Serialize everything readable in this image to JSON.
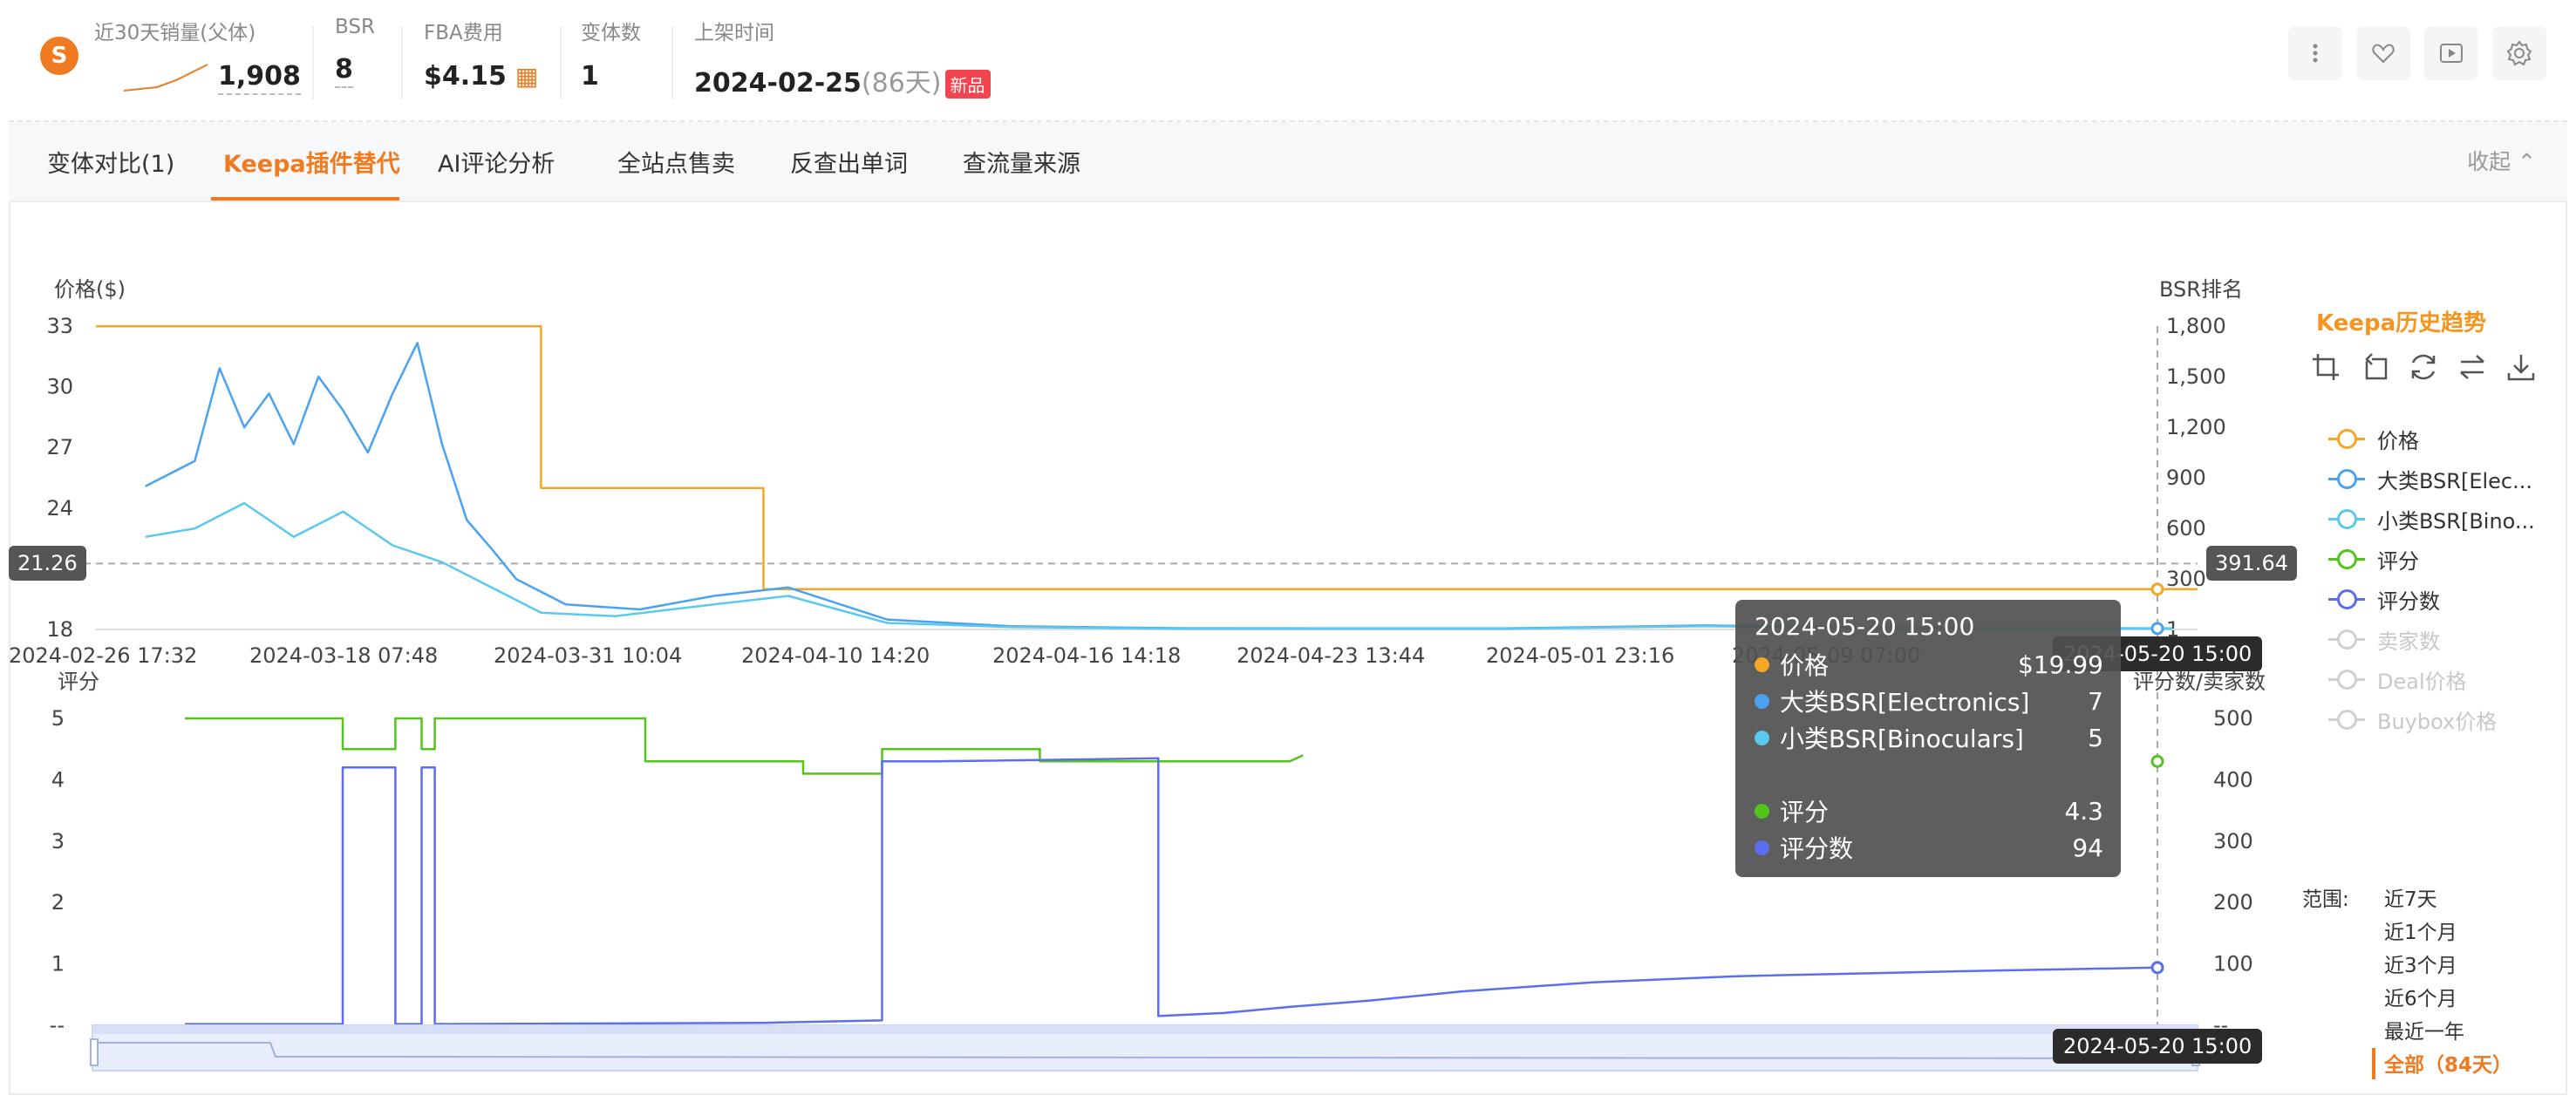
{
  "stats": {
    "sales_label": "近30天销量(父体)",
    "sales_value": "1,908",
    "bsr_label": "BSR",
    "bsr_value": "8",
    "fba_label": "FBA费用",
    "fba_value": "$4.15",
    "variants_label": "变体数",
    "variants_value": "1",
    "launch_label": "上架时间",
    "launch_date": "2024-02-25",
    "launch_days": "(86天)",
    "new_badge": "新品"
  },
  "toolbar_icons": [
    "more-icon",
    "heart-icon",
    "video-icon",
    "settings-icon"
  ],
  "tabs": [
    {
      "label": "变体对比(1)",
      "active": false
    },
    {
      "label": "Keepa插件替代",
      "active": true
    },
    {
      "label": "AI评论分析",
      "active": false
    },
    {
      "label": "全站点售卖",
      "active": false
    },
    {
      "label": "反查出单词",
      "active": false
    },
    {
      "label": "查流量来源",
      "active": false
    }
  ],
  "collapse_label": "收起",
  "keepa": {
    "title": "Keepa历史趋势",
    "tools": [
      "zoom-in-icon",
      "zoom-reset-icon",
      "refresh-icon",
      "swap-icon",
      "download-icon"
    ],
    "legend": [
      {
        "label": "价格",
        "color": "#f5a623",
        "active": true
      },
      {
        "label": "大类BSR[Elec...",
        "color": "#4aa3f0",
        "active": true
      },
      {
        "label": "小类BSR[Bino...",
        "color": "#5bc8ef",
        "active": true
      },
      {
        "label": "评分",
        "color": "#52c41a",
        "active": true
      },
      {
        "label": "评分数",
        "color": "#5b6ef0",
        "active": true
      },
      {
        "label": "卖家数",
        "color": "#d0d0d0",
        "active": false
      },
      {
        "label": "Deal价格",
        "color": "#d0d0d0",
        "active": false
      },
      {
        "label": "Buybox价格",
        "color": "#d0d0d0",
        "active": false
      }
    ],
    "range_label": "范围:",
    "range_options": [
      "近7天",
      "近1个月",
      "近3个月",
      "近6个月",
      "最近一年",
      "全部（84天）"
    ],
    "range_active": 5
  },
  "tooltip": {
    "title": "2024-05-20 15:00",
    "rows": [
      {
        "name": "价格",
        "value": "$19.99",
        "color": "#f5a623"
      },
      {
        "name": "大类BSR[Electronics]",
        "value": "7",
        "color": "#4aa3f0"
      },
      {
        "name": "小类BSR[Binoculars]",
        "value": "5",
        "color": "#5bc8ef"
      },
      {
        "name": "评分",
        "value": "4.3",
        "color": "#52c41a"
      },
      {
        "name": "评分数",
        "value": "94",
        "color": "#5b6ef0"
      }
    ]
  },
  "crosshair": {
    "price_value": "21.26",
    "bsr_value": "391.64",
    "time_label": "2024-05-20 15:00",
    "time_label_bottom": "2024-05-20 15:00"
  },
  "chart_data": [
    {
      "type": "line",
      "title": "",
      "ylabel": "价格($)",
      "ylabel_right": "BSR排名",
      "ylim": [
        18,
        33
      ],
      "ylim_right": [
        1,
        1800
      ],
      "yticks": [
        "33",
        "30",
        "27",
        "24",
        "21",
        "18"
      ],
      "yticks_right": [
        "1,800",
        "1,500",
        "1,200",
        "900",
        "600",
        "300",
        "1"
      ],
      "x_tick_labels": [
        "2024-02-26 17:32",
        "2024-03-18 07:48",
        "2024-03-31 10:04",
        "2024-04-10 14:20",
        "2024-04-16 14:18",
        "2024-04-23 13:44",
        "2024-05-01 23:16",
        "2024-05-09 07:00",
        "2024-05-20 15:00"
      ],
      "x_start": "2024-02-26",
      "x_end": "2024-05-21",
      "series": [
        {
          "name": "价格",
          "axis": "left",
          "color": "#f5a623",
          "points": [
            [
              "2024-02-26",
              32.99
            ],
            [
              "2024-03-15",
              32.99
            ],
            [
              "2024-03-15",
              24.99
            ],
            [
              "2024-03-24",
              24.99
            ],
            [
              "2024-03-24",
              19.99
            ],
            [
              "2024-05-21",
              19.99
            ]
          ]
        },
        {
          "name": "大类BSR[Electronics]",
          "axis": "right",
          "color": "#4aa3f0",
          "points": [
            [
              "2024-02-28",
              850
            ],
            [
              "2024-03-01",
              1000
            ],
            [
              "2024-03-02",
              1550
            ],
            [
              "2024-03-03",
              1200
            ],
            [
              "2024-03-04",
              1400
            ],
            [
              "2024-03-05",
              1100
            ],
            [
              "2024-03-06",
              1500
            ],
            [
              "2024-03-07",
              1300
            ],
            [
              "2024-03-08",
              1050
            ],
            [
              "2024-03-09",
              1400
            ],
            [
              "2024-03-10",
              1700
            ],
            [
              "2024-03-11",
              1100
            ],
            [
              "2024-03-12",
              650
            ],
            [
              "2024-03-13",
              480
            ],
            [
              "2024-03-14",
              300
            ],
            [
              "2024-03-16",
              150
            ],
            [
              "2024-03-19",
              120
            ],
            [
              "2024-03-22",
              200
            ],
            [
              "2024-03-25",
              250
            ],
            [
              "2024-03-29",
              60
            ],
            [
              "2024-04-03",
              20
            ],
            [
              "2024-04-10",
              8
            ],
            [
              "2024-04-23",
              7
            ],
            [
              "2024-05-01",
              25
            ],
            [
              "2024-05-09",
              10
            ],
            [
              "2024-05-20",
              7
            ]
          ]
        },
        {
          "name": "小类BSR[Binoculars]",
          "axis": "right",
          "color": "#5bc8ef",
          "points": [
            [
              "2024-02-28",
              550
            ],
            [
              "2024-03-01",
              600
            ],
            [
              "2024-03-03",
              750
            ],
            [
              "2024-03-05",
              550
            ],
            [
              "2024-03-07",
              700
            ],
            [
              "2024-03-09",
              500
            ],
            [
              "2024-03-11",
              400
            ],
            [
              "2024-03-13",
              250
            ],
            [
              "2024-03-15",
              100
            ],
            [
              "2024-03-18",
              80
            ],
            [
              "2024-03-22",
              150
            ],
            [
              "2024-03-25",
              200
            ],
            [
              "2024-03-29",
              40
            ],
            [
              "2024-04-03",
              15
            ],
            [
              "2024-04-10",
              5
            ],
            [
              "2024-04-23",
              5
            ],
            [
              "2024-05-01",
              20
            ],
            [
              "2024-05-09",
              8
            ],
            [
              "2024-05-20",
              5
            ]
          ]
        }
      ]
    },
    {
      "type": "line",
      "title": "",
      "ylabel": "评分",
      "ylabel_right": "评分数/卖家数",
      "ylim": [
        0,
        5
      ],
      "ylim_right": [
        0,
        500
      ],
      "yticks": [
        "5",
        "4",
        "3",
        "2",
        "1",
        "--"
      ],
      "yticks_right": [
        "500",
        "400",
        "300",
        "200",
        "100",
        "--"
      ],
      "series": [
        {
          "name": "评分",
          "axis": "left",
          "color": "#52c41a",
          "points": [
            [
              "2024-02-26",
              5.0
            ],
            [
              "2024-03-09",
              5.0
            ],
            [
              "2024-03-09",
              4.5
            ],
            [
              "2024-03-13",
              4.5
            ],
            [
              "2024-03-13",
              5.0
            ],
            [
              "2024-03-15",
              5.0
            ],
            [
              "2024-03-15",
              4.5
            ],
            [
              "2024-03-16",
              4.5
            ],
            [
              "2024-03-16",
              5.0
            ],
            [
              "2024-04-01",
              5.0
            ],
            [
              "2024-04-01",
              4.3
            ],
            [
              "2024-04-13",
              4.3
            ],
            [
              "2024-04-13",
              4.1
            ],
            [
              "2024-04-19",
              4.1
            ],
            [
              "2024-04-19",
              4.5
            ],
            [
              "2024-05-01",
              4.5
            ],
            [
              "2024-05-01",
              4.3
            ],
            [
              "2024-05-20",
              4.3
            ],
            [
              "2024-05-21",
              4.4
            ]
          ]
        },
        {
          "name": "评分数",
          "axis": "right",
          "color": "#5b6ef0",
          "points": [
            [
              "2024-02-26",
              2
            ],
            [
              "2024-03-09",
              2
            ],
            [
              "2024-03-09",
              420
            ],
            [
              "2024-03-13",
              420
            ],
            [
              "2024-03-13",
              2
            ],
            [
              "2024-03-15",
              2
            ],
            [
              "2024-03-15",
              420
            ],
            [
              "2024-03-16",
              420
            ],
            [
              "2024-03-16",
              2
            ],
            [
              "2024-04-10",
              4
            ],
            [
              "2024-04-19",
              8
            ],
            [
              "2024-04-19",
              430
            ],
            [
              "2024-04-23",
              430
            ],
            [
              "2024-05-10",
              435
            ],
            [
              "2024-05-10",
              15
            ],
            [
              "2024-05-15",
              20
            ],
            [
              "2024-05-20",
              30
            ],
            [
              "2024-05-26",
              40
            ],
            [
              "2024-06-02",
              55
            ],
            [
              "2024-06-12",
              70
            ],
            [
              "2024-06-23",
              80
            ],
            [
              "2024-07-10",
              88
            ],
            [
              "2024-07-25",
              94
            ]
          ]
        }
      ]
    }
  ]
}
